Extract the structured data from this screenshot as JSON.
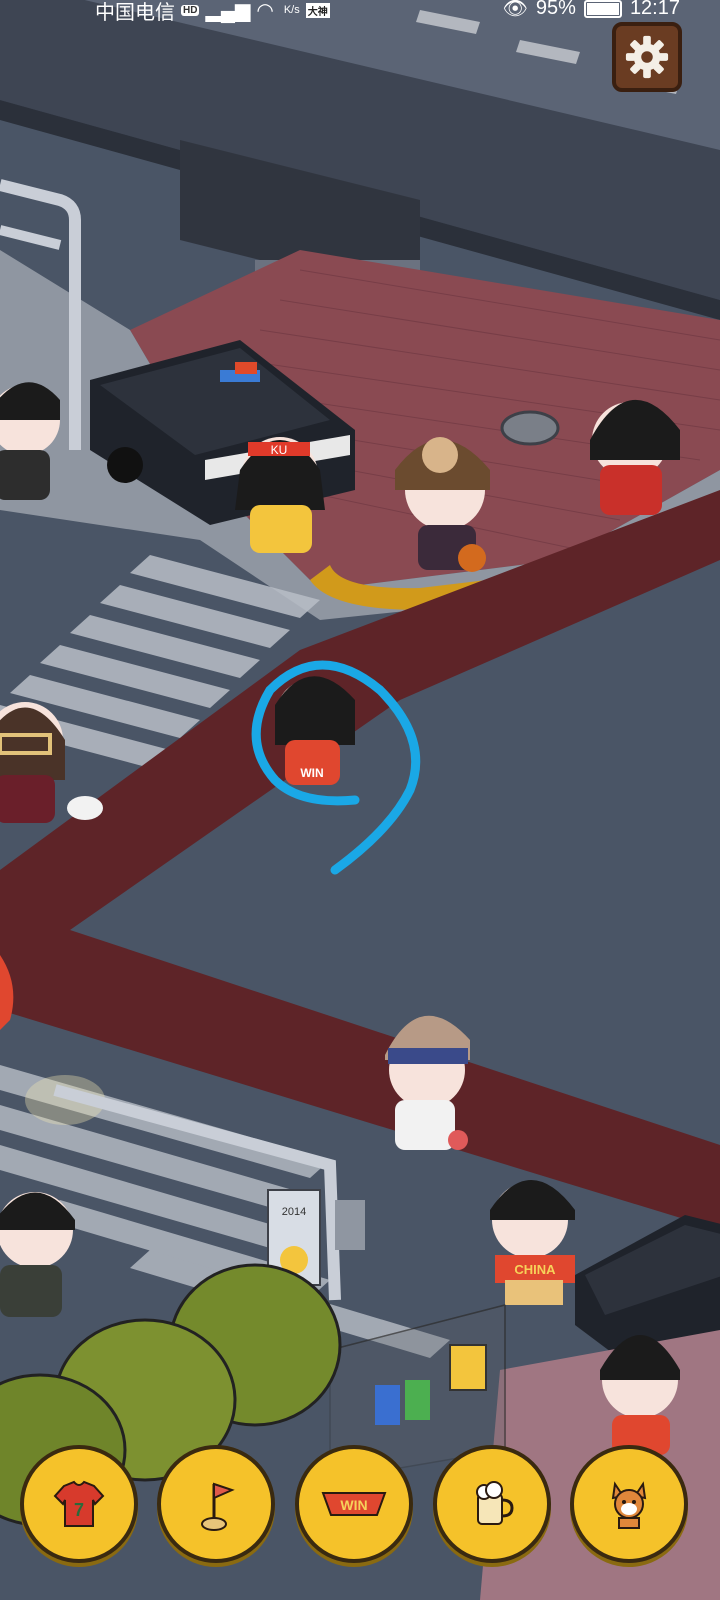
{
  "status_bar": {
    "carrier": "中国电信",
    "hd_badge": "HD",
    "speed_unit": "K/s",
    "net_badge": "大神",
    "battery": "95%",
    "time": "12:17",
    "battery_level": 0.95
  },
  "scene": {
    "labels": {
      "character_shirt_win": "WIN",
      "fan_scarf": "CHINA",
      "headband_text": "KU",
      "banner_year": "2014"
    },
    "colors": {
      "road": "#4a5566",
      "red_lane": "#5e2428",
      "sidewalk_brick": "#8a4a52",
      "highlight_circle": "#1aa8e6"
    }
  },
  "toolbar": {
    "items": [
      {
        "icon": "jersey-icon",
        "label": "7"
      },
      {
        "icon": "flag-pin-icon",
        "label": ""
      },
      {
        "icon": "win-scarf-icon",
        "label": "WIN"
      },
      {
        "icon": "beer-mug-icon",
        "label": ""
      },
      {
        "icon": "dog-icon",
        "label": ""
      }
    ]
  },
  "settings": {
    "icon": "gear-icon"
  }
}
